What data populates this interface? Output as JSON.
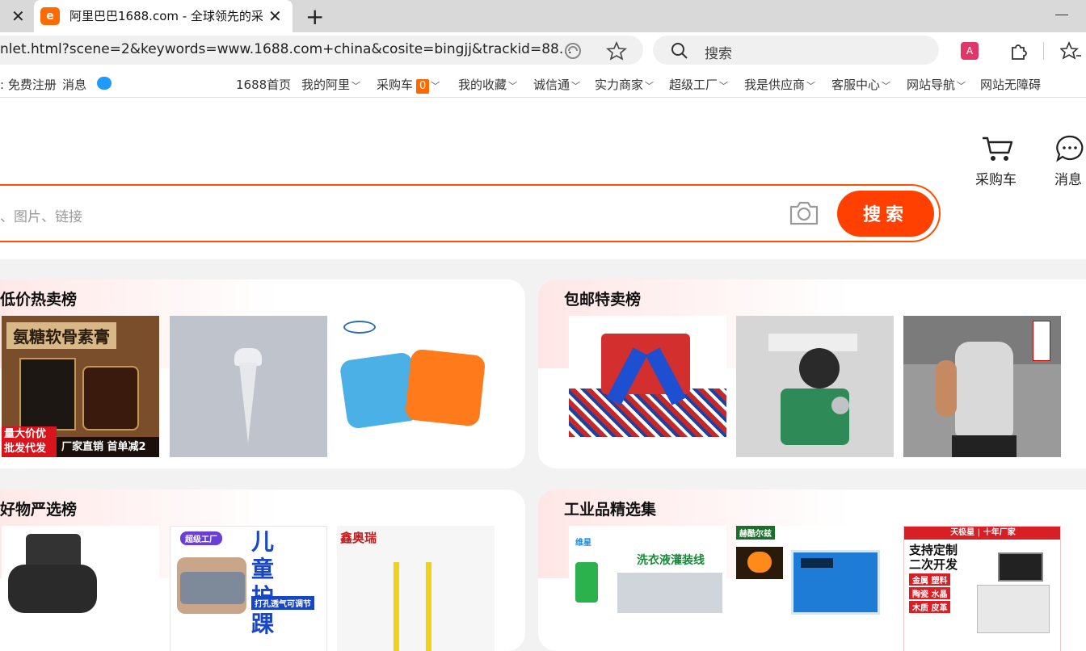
{
  "browser": {
    "tab_title": "阿里巴巴1688.com - 全球领先的采",
    "favicon_text": "e",
    "url": "nlet.html?scene=2&keywords=www.1688.com+china&cosite=bingjj&trackid=88...",
    "search_placeholder": "搜索"
  },
  "nav": {
    "left": [
      "免费注册",
      "消息"
    ],
    "items": [
      {
        "label": "1688首页",
        "chevron": false
      },
      {
        "label": "我的阿里",
        "chevron": true
      },
      {
        "label": "采购车",
        "chevron": true,
        "badge": "0"
      },
      {
        "label": "我的收藏",
        "chevron": true
      },
      {
        "label": "诚信通",
        "chevron": true
      },
      {
        "label": "实力商家",
        "chevron": true
      },
      {
        "label": "超级工厂",
        "chevron": true
      },
      {
        "label": "我是供应商",
        "chevron": true
      },
      {
        "label": "客服中心",
        "chevron": true
      },
      {
        "label": "网站导航",
        "chevron": true
      },
      {
        "label": "网站无障碍",
        "chevron": false
      }
    ]
  },
  "header": {
    "cart_label": "采购车",
    "message_label": "消息",
    "search_placeholder": "、图片、链接",
    "search_button": "搜索"
  },
  "sections": {
    "low_price": {
      "title": "低价热卖榜",
      "p1": {
        "title": "氨糖软骨素膏",
        "banner_left": [
          "量大价优",
          "批发代发"
        ],
        "banner_right": "厂家直销 首单减2"
      }
    },
    "free_shipping": {
      "title": "包邮特卖榜"
    },
    "good_items": {
      "title": "好物严选榜",
      "p2_title": "儿童护踝",
      "p2_tag": "超级工厂",
      "p2_sub": "打孔透气可调节",
      "p3_logo": "鑫奥瑞"
    },
    "industrial": {
      "title": "工业品精选集",
      "p1_text": "洗衣液灌装线",
      "p1_logo": "维星",
      "p2_logo": "赫酷尔兹",
      "p3_header": "天极星 | 十年厂家",
      "p3_lines": [
        "支持定制",
        "二次开发"
      ],
      "p3_tags": [
        "金属 塑料",
        "陶瓷 水晶",
        "木质 皮革"
      ]
    }
  },
  "colors": {
    "brand": "#ff5000",
    "button": "#ff4000",
    "badge": "#ff6a00"
  }
}
